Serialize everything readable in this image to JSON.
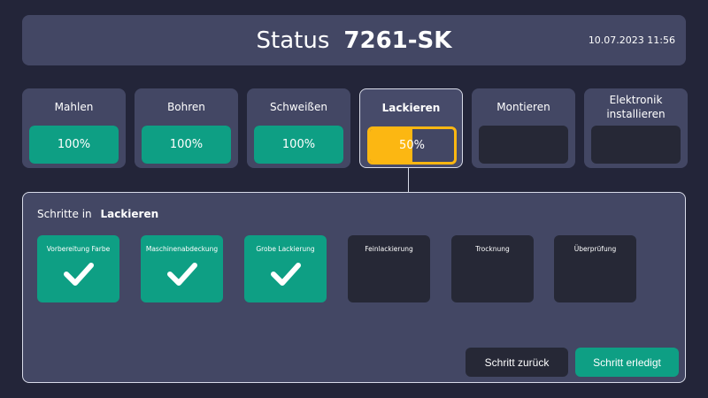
{
  "header": {
    "label": "Status",
    "code": "7261-SK",
    "datetime": "10.07.2023 11:56"
  },
  "stages": [
    {
      "name": "Mahlen",
      "progress": 100,
      "progress_label": "100%",
      "state": "done"
    },
    {
      "name": "Bohren",
      "progress": 100,
      "progress_label": "100%",
      "state": "done"
    },
    {
      "name": "Schweißen",
      "progress": 100,
      "progress_label": "100%",
      "state": "done"
    },
    {
      "name": "Lackieren",
      "progress": 50,
      "progress_label": "50%",
      "state": "active"
    },
    {
      "name": "Montieren",
      "progress": 0,
      "progress_label": "",
      "state": "pending"
    },
    {
      "name": "Elektronik installieren",
      "progress": 0,
      "progress_label": "",
      "state": "pending"
    }
  ],
  "panel": {
    "title_prefix": "Schritte in",
    "title_stage": "Lackieren",
    "steps": [
      {
        "name": "Vorbereitung Farbe",
        "done": true
      },
      {
        "name": "Maschinenabdeckung",
        "done": true
      },
      {
        "name": "Grobe Lackierung",
        "done": true
      },
      {
        "name": "Feinlackierung",
        "done": false
      },
      {
        "name": "Trocknung",
        "done": false
      },
      {
        "name": "Überprüfung",
        "done": false
      }
    ],
    "back_label": "Schritt zurück",
    "done_label": "Schritt erledigt"
  },
  "colors": {
    "done": "#0e9f84",
    "active": "#fcb712",
    "card": "#434764",
    "background": "#232539"
  }
}
